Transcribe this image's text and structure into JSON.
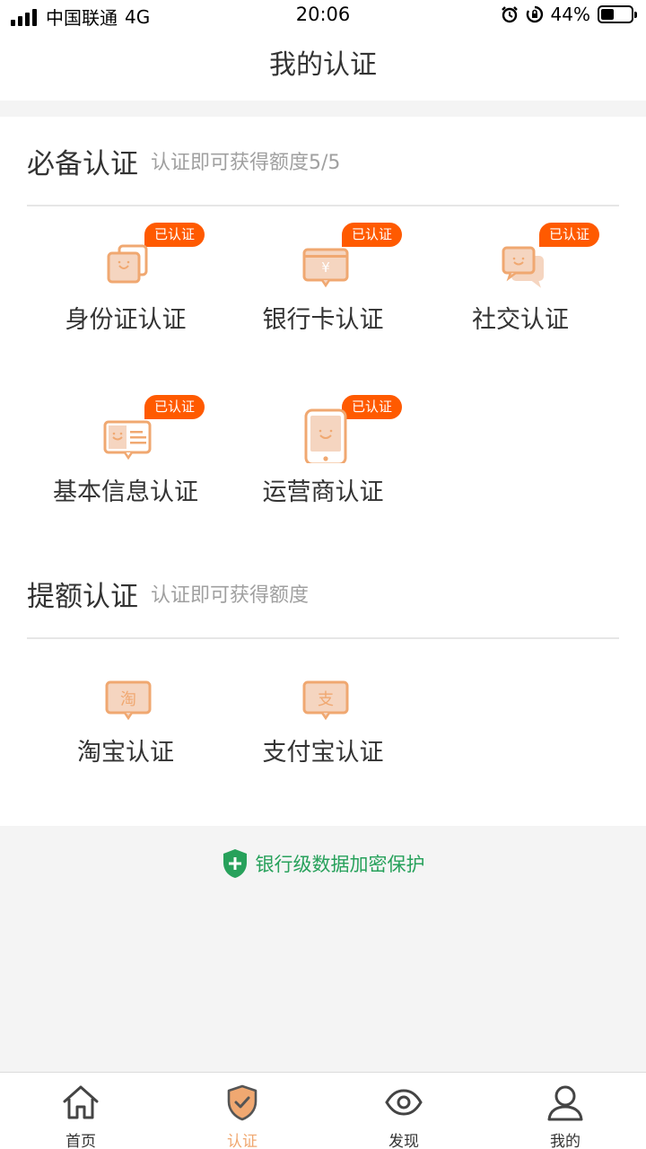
{
  "status_bar": {
    "carrier": "中国联通",
    "network": "4G",
    "time": "20:06",
    "battery": "44%",
    "battery_level": 0.44
  },
  "nav": {
    "title": "我的认证"
  },
  "required_section": {
    "title": "必备认证",
    "subtitle": "认证即可获得额度5/5",
    "items": [
      {
        "label": "身份证认证",
        "badge": "已认证",
        "icon": "id-card-icon"
      },
      {
        "label": "银行卡认证",
        "badge": "已认证",
        "icon": "bank-card-icon",
        "glyph": "¥"
      },
      {
        "label": "社交认证",
        "badge": "已认证",
        "icon": "social-chat-icon"
      },
      {
        "label": "基本信息认证",
        "badge": "已认证",
        "icon": "basic-info-icon"
      },
      {
        "label": "运营商认证",
        "badge": "已认证",
        "icon": "phone-carrier-icon"
      }
    ]
  },
  "increase_section": {
    "title": "提额认证",
    "subtitle": "认证即可获得额度",
    "items": [
      {
        "label": "淘宝认证",
        "icon": "taobao-icon",
        "glyph": "淘"
      },
      {
        "label": "支付宝认证",
        "icon": "alipay-icon",
        "glyph": "支"
      }
    ]
  },
  "security": {
    "text": "银行级数据加密保护"
  },
  "tabs": [
    {
      "label": "首页",
      "icon": "home-icon"
    },
    {
      "label": "认证",
      "icon": "shield-check-icon",
      "active": true
    },
    {
      "label": "发现",
      "icon": "eye-icon"
    },
    {
      "label": "我的",
      "icon": "user-icon"
    }
  ],
  "colors": {
    "accent": "#f0a871",
    "icon_fill": "#f5d5c0",
    "badge": "#ff5a00",
    "security": "#27a15b"
  }
}
